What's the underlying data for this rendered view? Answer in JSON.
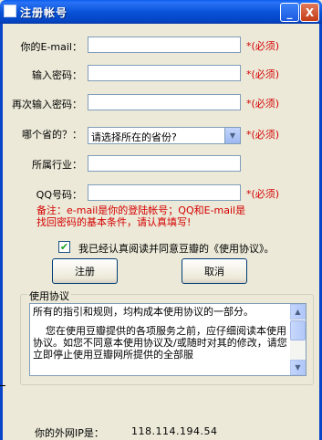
{
  "window": {
    "title": "注册帐号",
    "min_symbol": "_",
    "close_symbol": "X"
  },
  "form": {
    "email_label": "你的E-mail：",
    "password_label": "输入密码：",
    "password2_label": "再次输入密码：",
    "province_label": "哪个省的？：",
    "province_selected": "请选择所在的省份?",
    "industry_label": "所属行业：",
    "qq_label": "QQ号码：",
    "required_text": "*(必须)"
  },
  "note": {
    "line1": "备注：e-mail是你的登陆帐号；QQ和E-mail是",
    "line2": "找回密码的基本条件，请认真填写!"
  },
  "agree": {
    "checked": true,
    "check_mark": "✔",
    "label": "我已经认真阅读并同意豆瓣的《使用协议》。"
  },
  "buttons": {
    "register": "注册",
    "cancel": "取消"
  },
  "agreement": {
    "title": "使用协议",
    "para1": "所有的指引和规则，均构成本使用协议的一部分。",
    "para2": "    您在使用豆瓣提供的各项服务之前，应仔细阅读本使用协议。如您不同意本使用协议及/或随时对其的修改，请您立即停止使用豆瓣网所提供的全部服"
  },
  "ip": {
    "label": "你的外网IP是：",
    "value": "118.114.194.54"
  },
  "colors": {
    "accent_red": "#d40000",
    "titlebar_blue": "#0853d8"
  }
}
